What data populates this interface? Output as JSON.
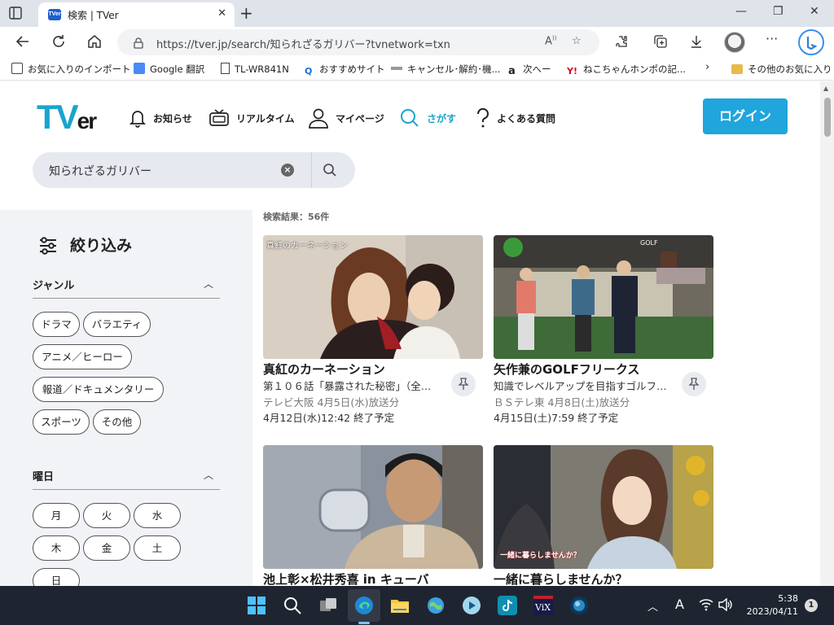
{
  "browser": {
    "tab_title": "検索 | TVer",
    "tab_favicon": "TVer",
    "url": "https://tver.jp/search/知られざるガリバー?tvnetwork=txn"
  },
  "favorites": [
    {
      "label": "お気に入りのインポート",
      "icon": "import-icon"
    },
    {
      "label": "Google 翻訳",
      "icon": "google-translate-icon"
    },
    {
      "label": "TL-WR841N",
      "icon": "page-icon"
    },
    {
      "label": "おすすめサイト",
      "icon": "search-icon"
    },
    {
      "label": "キャンセル･解約･機...",
      "icon": "bar-icon"
    },
    {
      "label": "次へー",
      "icon": "amazon-icon"
    },
    {
      "label": "ねこちゃんホンポの記...",
      "icon": "yahoo-icon"
    },
    {
      "label": "その他のお気に入り",
      "icon": "folder-icon"
    }
  ],
  "header": {
    "logo": {
      "t": "T",
      "v": "V",
      "er": "er"
    },
    "nav": [
      {
        "label": "お知らせ",
        "icon": "bell-icon"
      },
      {
        "label": "リアルタイム",
        "icon": "tv-icon"
      },
      {
        "label": "マイページ",
        "icon": "user-icon"
      },
      {
        "label": "さがす",
        "icon": "search-icon"
      },
      {
        "label": "よくある質問",
        "icon": "question-icon"
      }
    ],
    "login_label": "ログイン"
  },
  "search": {
    "query": "知られざるガリバー"
  },
  "filters": {
    "title": "絞り込み",
    "genre": {
      "title": "ジャンル",
      "chips": [
        "ドラマ",
        "バラエティ",
        "アニメ／ヒーロー",
        "報道／ドキュメンタリー",
        "スポーツ",
        "その他"
      ]
    },
    "weekday": {
      "title": "曜日",
      "chips": [
        "月",
        "火",
        "水",
        "木",
        "金",
        "土",
        "日"
      ]
    }
  },
  "results": {
    "count_label": "検索結果：56件",
    "cards": [
      {
        "title": "真紅のカーネーション",
        "subtitle": "第１０６話「暴露された秘密」（全…",
        "station": "テレビ大阪 4月5日(水)放送分",
        "expire": "4月12日(水)12:42 終了予定",
        "thumb_caption": "真紅のカーネーション"
      },
      {
        "title": "矢作兼のGOLFフリークス",
        "subtitle": "知識でレベルアップを目指すゴルフ…",
        "station": "ＢＳテレ東 4月8日(土)放送分",
        "expire": "4月15日(土)7:59 終了予定",
        "thumb_caption": ""
      },
      {
        "title": "池上彰×松井秀喜 in キューバ",
        "subtitle": "",
        "station": "",
        "expire": "",
        "thumb_caption": ""
      },
      {
        "title": "一緒に暮らしませんか？",
        "subtitle": "",
        "station": "",
        "expire": "",
        "thumb_caption": "一緒に暮らしませんか？"
      }
    ]
  },
  "taskbar": {
    "time": "5:38",
    "date": "2023/04/11",
    "notification_count": "1",
    "ime": "A"
  },
  "colors": {
    "brand": "#1aa4ce",
    "login": "#20a5dc",
    "taskbar": "#1f2530"
  }
}
